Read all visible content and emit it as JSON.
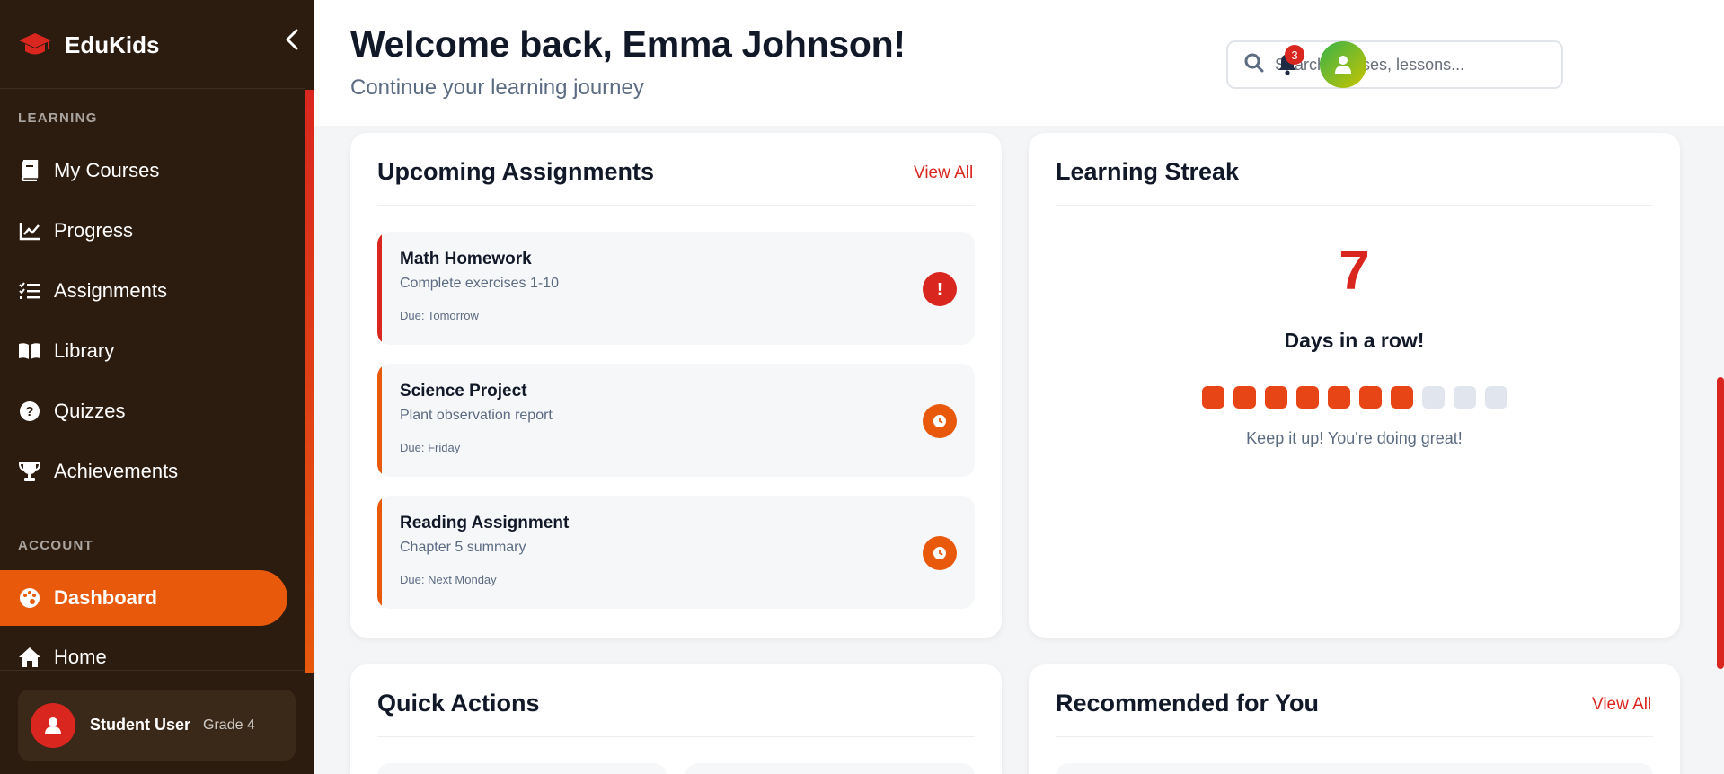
{
  "sidebar": {
    "brand": "EduKids",
    "section_learning": "LEARNING",
    "section_account": "ACCOUNT",
    "learning_items": [
      {
        "label": "My Courses"
      },
      {
        "label": "Progress"
      },
      {
        "label": "Assignments"
      },
      {
        "label": "Library"
      },
      {
        "label": "Quizzes"
      },
      {
        "label": "Achievements"
      }
    ],
    "account_items": [
      {
        "label": "Dashboard",
        "active": true
      },
      {
        "label": "Home"
      }
    ],
    "user": {
      "name": "Student User",
      "grade": "Grade 4"
    }
  },
  "header": {
    "welcome": "Welcome back, Emma Johnson!",
    "subtitle": "Continue your learning journey",
    "search_placeholder": "Search courses, lessons...",
    "notification_count": "3"
  },
  "assignments": {
    "title": "Upcoming Assignments",
    "view_all": "View All",
    "items": [
      {
        "title": "Math Homework",
        "desc": "Complete exercises 1-10",
        "due": "Due: Tomorrow",
        "status_icon": "exclamation-icon",
        "color": "#d9271f"
      },
      {
        "title": "Science Project",
        "desc": "Plant observation report",
        "due": "Due: Friday",
        "status_icon": "clock-icon",
        "color": "#e8590c"
      },
      {
        "title": "Reading Assignment",
        "desc": "Chapter 5 summary",
        "due": "Due: Next Monday",
        "status_icon": "clock-icon",
        "color": "#e8590c"
      }
    ]
  },
  "streak": {
    "title": "Learning Streak",
    "days": "7",
    "label": "Days in a row!",
    "filled": 7,
    "total": 10,
    "message": "Keep it up! You're doing great!"
  },
  "quick_actions": {
    "title": "Quick Actions"
  },
  "recommended": {
    "title": "Recommended for You",
    "view_all": "View All"
  },
  "colors": {
    "accent": "#e8590c",
    "danger": "#d9271f",
    "sidebar_bg": "#2c1c10"
  }
}
